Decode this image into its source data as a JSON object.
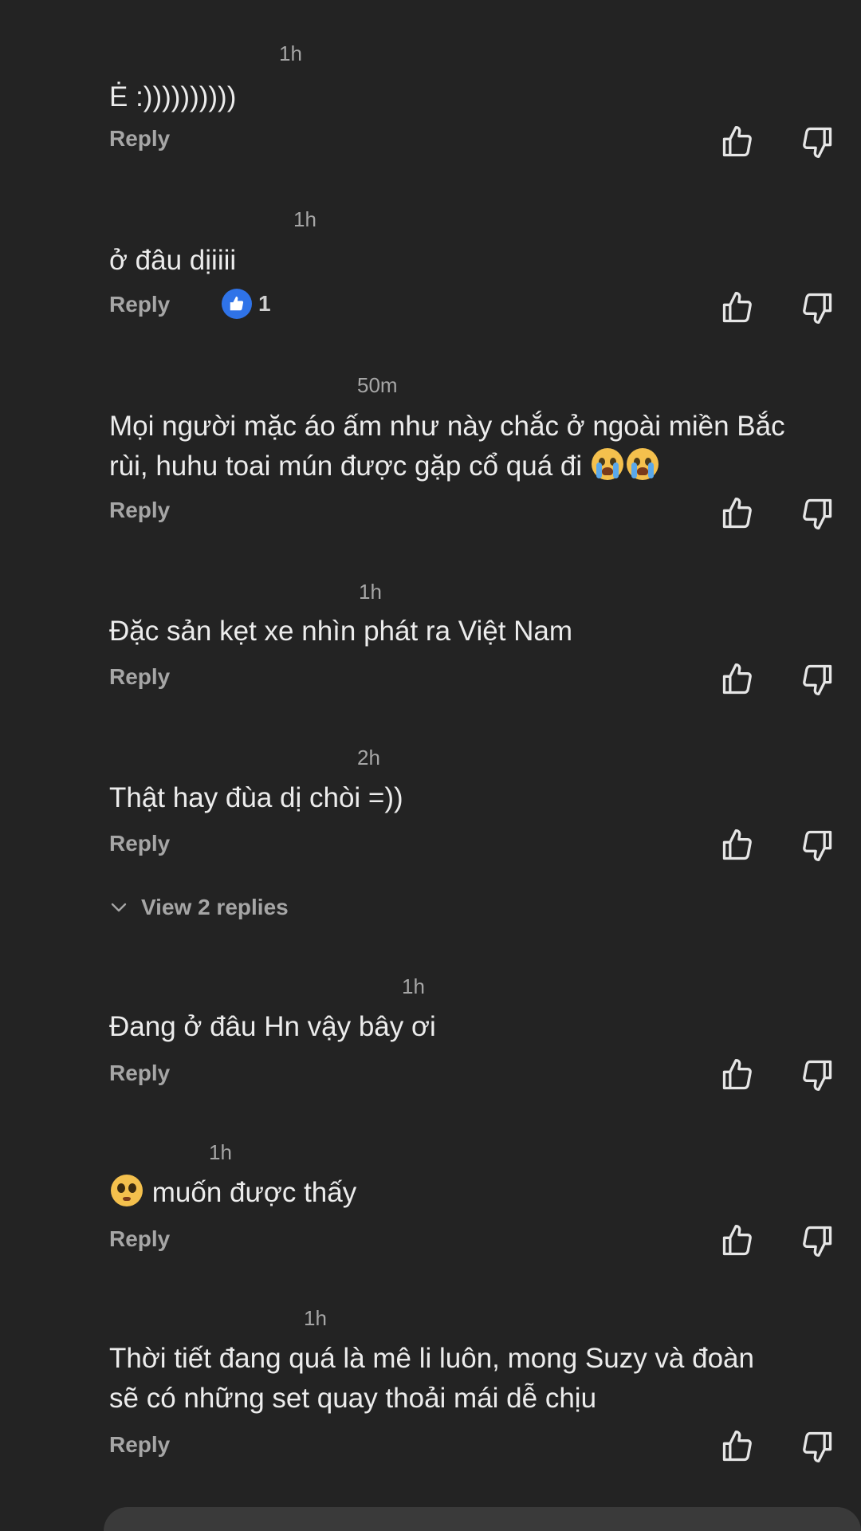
{
  "comments": [
    {
      "time": "1h",
      "text": "Ė :))))))))))",
      "reply": "Reply"
    },
    {
      "time": "1h",
      "text": "ở đâu dịiiii",
      "reply": "Reply",
      "likes": "1"
    },
    {
      "time": "50m",
      "text": "Mọi người mặc áo ấm như này chắc ở ngoài miền Bắc\nrùi, huhu toai mún được gặp cổ quá đi",
      "emojis": [
        "crying-face",
        "crying-face"
      ],
      "reply": "Reply"
    },
    {
      "time": "1h",
      "text": "Đặc sản kẹt xe nhìn phát ra Việt Nam",
      "reply": "Reply"
    },
    {
      "time": "2h",
      "text": "Thật hay đùa dị chòi =))",
      "reply": "Reply"
    },
    {
      "time": "1h",
      "text": "Đang ở đâu Hn vậy bây ơi",
      "reply": "Reply"
    },
    {
      "time": "1h",
      "text": "muốn được thấy",
      "emojis": [
        "pleading-face"
      ],
      "reply": "Reply"
    },
    {
      "time": "1h",
      "text": "Thời tiết đang quá là mê li luôn, mong Suzy và đoàn\nsẽ có những set quay thoải mái dễ chịu",
      "reply": "Reply"
    }
  ],
  "view_replies": {
    "label": "View 2 replies",
    "icon": "chevron-down-icon"
  },
  "icons": {
    "like": "thumbs-up-icon",
    "dislike": "thumbs-down-icon",
    "like_badge": "blue-like-badge-icon"
  },
  "colors": {
    "background": "#232323",
    "text": "#ececec",
    "muted": "#a6a6a6",
    "like_badge": "#2f73e8"
  }
}
